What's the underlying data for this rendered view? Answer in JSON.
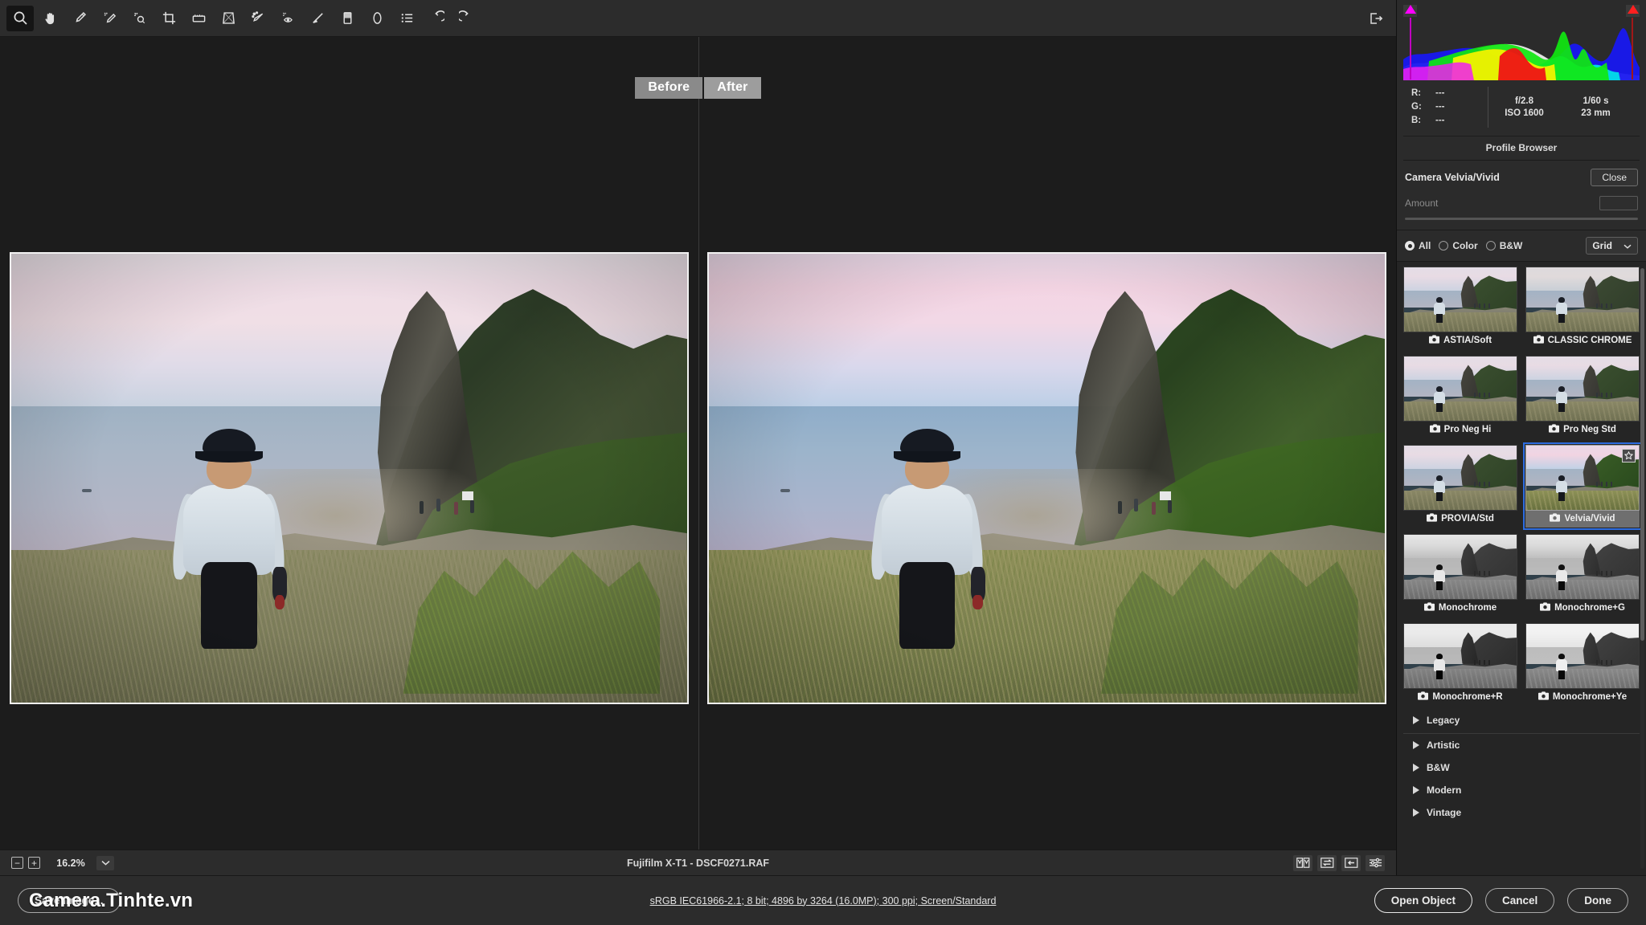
{
  "toolbar": {
    "tools": [
      {
        "name": "zoom-tool",
        "label": "Zoom",
        "active": true
      },
      {
        "name": "hand-tool",
        "label": "Hand",
        "active": false
      },
      {
        "name": "white-balance-tool",
        "label": "White Balance",
        "active": false
      },
      {
        "name": "color-sampler-tool",
        "label": "Color Sampler",
        "active": false
      },
      {
        "name": "targeted-adjustment-tool",
        "label": "Targeted Adjustment",
        "active": false
      },
      {
        "name": "crop-tool",
        "label": "Crop",
        "active": false
      },
      {
        "name": "straighten-tool",
        "label": "Straighten",
        "active": false
      },
      {
        "name": "transform-tool",
        "label": "Transform",
        "active": false
      },
      {
        "name": "spot-removal-tool",
        "label": "Spot Removal",
        "active": false
      },
      {
        "name": "red-eye-tool",
        "label": "Red Eye Removal",
        "active": false
      },
      {
        "name": "adjustment-brush-tool",
        "label": "Adjustment Brush",
        "active": false
      },
      {
        "name": "graduated-filter-tool",
        "label": "Graduated Filter",
        "active": false
      },
      {
        "name": "radial-filter-tool",
        "label": "Radial Filter",
        "active": false
      },
      {
        "name": "presets-tool",
        "label": "Presets",
        "active": false
      },
      {
        "name": "undo-tool",
        "label": "Undo",
        "active": false
      },
      {
        "name": "redo-tool",
        "label": "Redo",
        "active": false
      }
    ],
    "filmstrip_toggle_label": "Toggle Filmstrip"
  },
  "preview": {
    "tabs": [
      {
        "label": "Before",
        "selected": false
      },
      {
        "label": "After",
        "selected": true
      }
    ]
  },
  "statusbar": {
    "zoom_out_label": "−",
    "zoom_in_label": "+",
    "zoom_level": "16.2%",
    "file_info": "Fujifilm X-T1  -  DSCF0271.RAF",
    "view_buttons": [
      {
        "name": "before-after-left-right-icon",
        "label": "Before/After Left/Right"
      },
      {
        "name": "swap-before-after-icon",
        "label": "Swap Before/After Settings"
      },
      {
        "name": "copy-current-to-before-icon",
        "label": "Copy Current Settings to Before"
      },
      {
        "name": "preview-preferences-icon",
        "label": "Preview Preferences"
      }
    ]
  },
  "histogram": {
    "shadow_clip_name": "shadow-clipping-warning",
    "highlight_clip_name": "highlight-clipping-warning"
  },
  "readout": {
    "rgb": [
      {
        "channel": "R:",
        "value": "---"
      },
      {
        "channel": "G:",
        "value": "---"
      },
      {
        "channel": "B:",
        "value": "---"
      }
    ],
    "exif": [
      "f/2.8",
      "1/60 s",
      "ISO 1600",
      "23 mm"
    ]
  },
  "profile_panel": {
    "title": "Profile Browser",
    "current_profile": "Camera Velvia/Vivid",
    "close_label": "Close",
    "amount_label": "Amount",
    "amount_value": "",
    "filters": [
      {
        "label": "All",
        "selected": true
      },
      {
        "label": "Color",
        "selected": false
      },
      {
        "label": "B&W",
        "selected": false
      }
    ],
    "view_mode": "Grid",
    "profiles": [
      {
        "label": "ASTIA/Soft",
        "style": "soft",
        "selected": false
      },
      {
        "label": "CLASSIC CHROME",
        "style": "chrome",
        "selected": false
      },
      {
        "label": "Pro Neg Hi",
        "style": "soft",
        "selected": false
      },
      {
        "label": "Pro Neg Std",
        "style": "soft",
        "selected": false
      },
      {
        "label": "PROVIA/Std",
        "style": "soft",
        "selected": false
      },
      {
        "label": "Velvia/Vivid",
        "style": "vivid",
        "selected": true
      },
      {
        "label": "Monochrome",
        "style": "bw",
        "selected": false
      },
      {
        "label": "Monochrome+G",
        "style": "bw",
        "selected": false
      },
      {
        "label": "Monochrome+R",
        "style": "bwr",
        "selected": false
      },
      {
        "label": "Monochrome+Ye",
        "style": "bwye",
        "selected": false
      }
    ],
    "groups": [
      "Legacy",
      "Artistic",
      "B&W",
      "Modern",
      "Vintage"
    ]
  },
  "bottombar": {
    "save_image_label": "Save Image...",
    "color_profile_info": "sRGB IEC61966-2.1; 8 bit; 4896 by 3264 (16.0MP); 300 ppi; Screen/Standard",
    "buttons": [
      {
        "label": "Open Object",
        "primary": true
      },
      {
        "label": "Cancel",
        "primary": false
      },
      {
        "label": "Done",
        "primary": false
      }
    ]
  },
  "watermark": "Camera.Tinhte.vn",
  "colors": {
    "accent_selected": "#2d6cdf",
    "panel_bg": "#2b2b2b",
    "canvas_bg": "#1c1c1c",
    "clip_shadow": "#ff00ff",
    "clip_highlight": "#ff2020"
  }
}
